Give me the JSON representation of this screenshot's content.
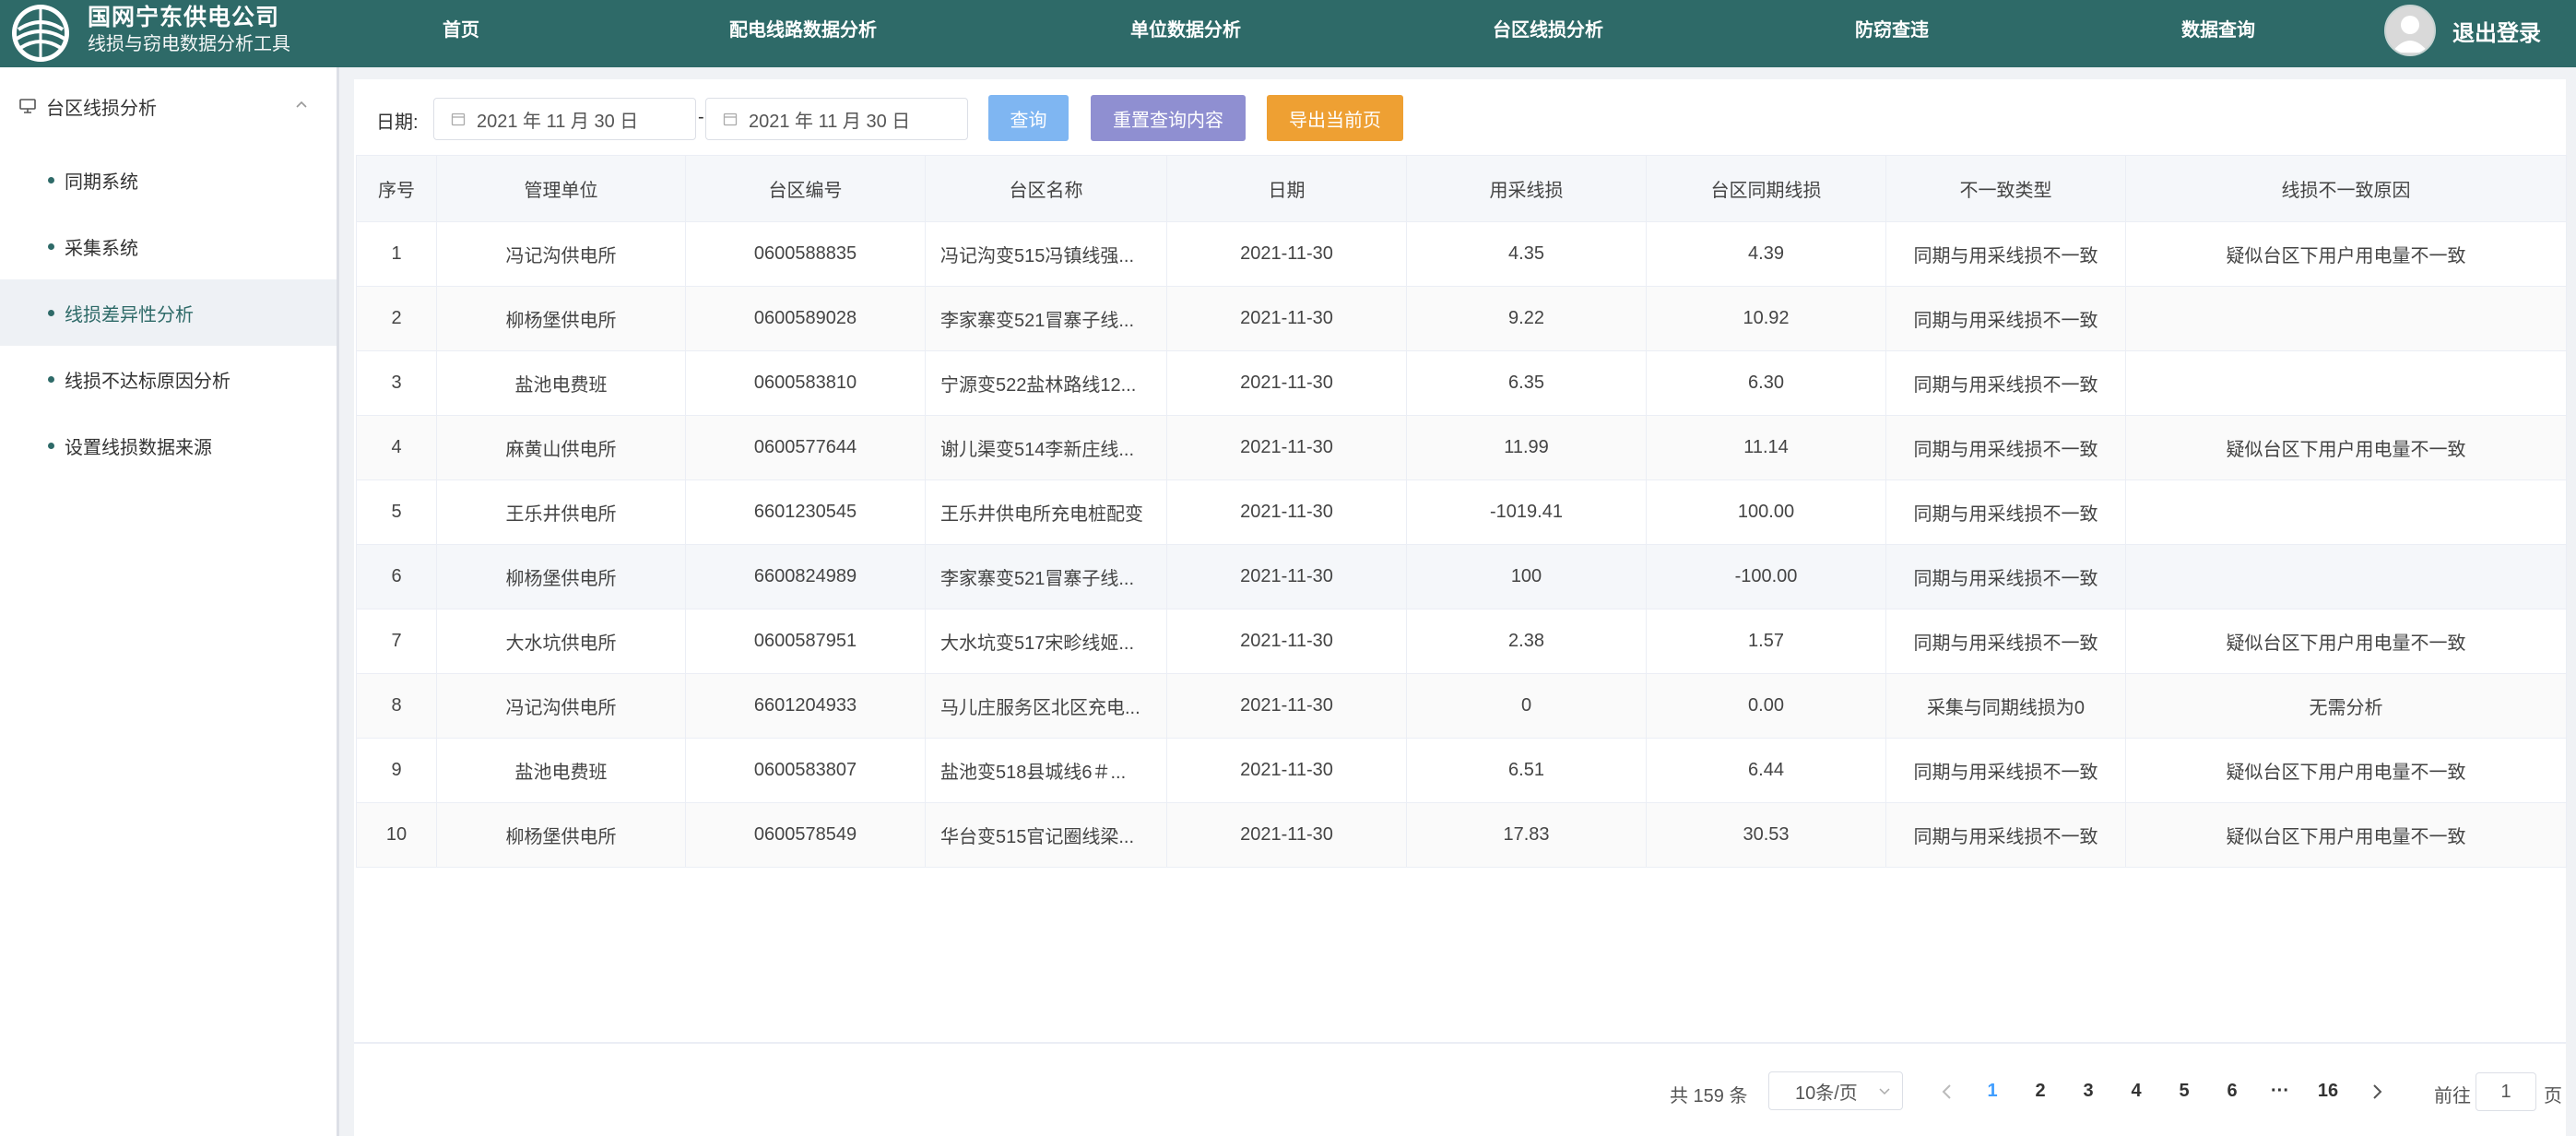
{
  "header": {
    "company": "国网宁东供电公司",
    "subtitle": "线损与窃电数据分析工具",
    "nav": [
      "首页",
      "配电线路数据分析",
      "单位数据分析",
      "台区线损分析",
      "防窃查违",
      "数据查询"
    ],
    "logout": "退出登录"
  },
  "sidebar": {
    "group": "台区线损分析",
    "items": [
      {
        "label": "同期系统",
        "active": false
      },
      {
        "label": "采集系统",
        "active": false
      },
      {
        "label": "线损差异性分析",
        "active": true
      },
      {
        "label": "线损不达标原因分析",
        "active": false
      },
      {
        "label": "设置线损数据来源",
        "active": false
      }
    ]
  },
  "filter": {
    "date_label": "日期:",
    "start_date": "2021 年 11 月 30 日",
    "end_date": "2021 年 11 月 30 日",
    "separator": "-",
    "query": "查询",
    "reset": "重置查询内容",
    "export": "导出当前页"
  },
  "colors": {
    "header": "#2e6a68",
    "query": "#7fb6f2",
    "reset": "#8f8fd1",
    "export": "#eea033",
    "page_active": "#409eff"
  },
  "table": {
    "columns": [
      "序号",
      "管理单位",
      "台区编号",
      "台区名称",
      "日期",
      "用采线损",
      "台区同期线损",
      "不一致类型",
      "线损不一致原因"
    ],
    "rows": [
      [
        "1",
        "冯记沟供电所",
        "0600588835",
        "冯记沟变515冯镇线强...",
        "2021-11-30",
        "4.35",
        "4.39",
        "同期与用采线损不一致",
        "疑似台区下用户用电量不一致"
      ],
      [
        "2",
        "柳杨堡供电所",
        "0600589028",
        "李家寨变521冒寨子线...",
        "2021-11-30",
        "9.22",
        "10.92",
        "同期与用采线损不一致",
        ""
      ],
      [
        "3",
        "盐池电费班",
        "0600583810",
        "宁源变522盐林路线12...",
        "2021-11-30",
        "6.35",
        "6.30",
        "同期与用采线损不一致",
        ""
      ],
      [
        "4",
        "麻黄山供电所",
        "0600577644",
        "谢儿渠变514李新庄线...",
        "2021-11-30",
        "11.99",
        "11.14",
        "同期与用采线损不一致",
        "疑似台区下用户用电量不一致"
      ],
      [
        "5",
        "王乐井供电所",
        "6601230545",
        "王乐井供电所充电桩配变",
        "2021-11-30",
        "-1019.41",
        "100.00",
        "同期与用采线损不一致",
        ""
      ],
      [
        "6",
        "柳杨堡供电所",
        "6600824989",
        "李家寨变521冒寨子线...",
        "2021-11-30",
        "100",
        "-100.00",
        "同期与用采线损不一致",
        ""
      ],
      [
        "7",
        "大水坑供电所",
        "0600587951",
        "大水坑变517宋畛线姬...",
        "2021-11-30",
        "2.38",
        "1.57",
        "同期与用采线损不一致",
        "疑似台区下用户用电量不一致"
      ],
      [
        "8",
        "冯记沟供电所",
        "6601204933",
        "马儿庄服务区北区充电...",
        "2021-11-30",
        "0",
        "0.00",
        "采集与同期线损为0",
        "无需分析"
      ],
      [
        "9",
        "盐池电费班",
        "0600583807",
        "盐池变518县城线6＃...",
        "2021-11-30",
        "6.51",
        "6.44",
        "同期与用采线损不一致",
        "疑似台区下用户用电量不一致"
      ],
      [
        "10",
        "柳杨堡供电所",
        "0600578549",
        "华台变515官记圈线梁...",
        "2021-11-30",
        "17.83",
        "30.53",
        "同期与用采线损不一致",
        "疑似台区下用户用电量不一致"
      ]
    ]
  },
  "pagination": {
    "total": "共 159 条",
    "page_size": "10条/页",
    "pages": [
      "1",
      "2",
      "3",
      "4",
      "5",
      "6"
    ],
    "ellipsis": "···",
    "last": "16",
    "current": "1",
    "goto_label": "前往",
    "goto_value": "1",
    "goto_unit": "页"
  }
}
